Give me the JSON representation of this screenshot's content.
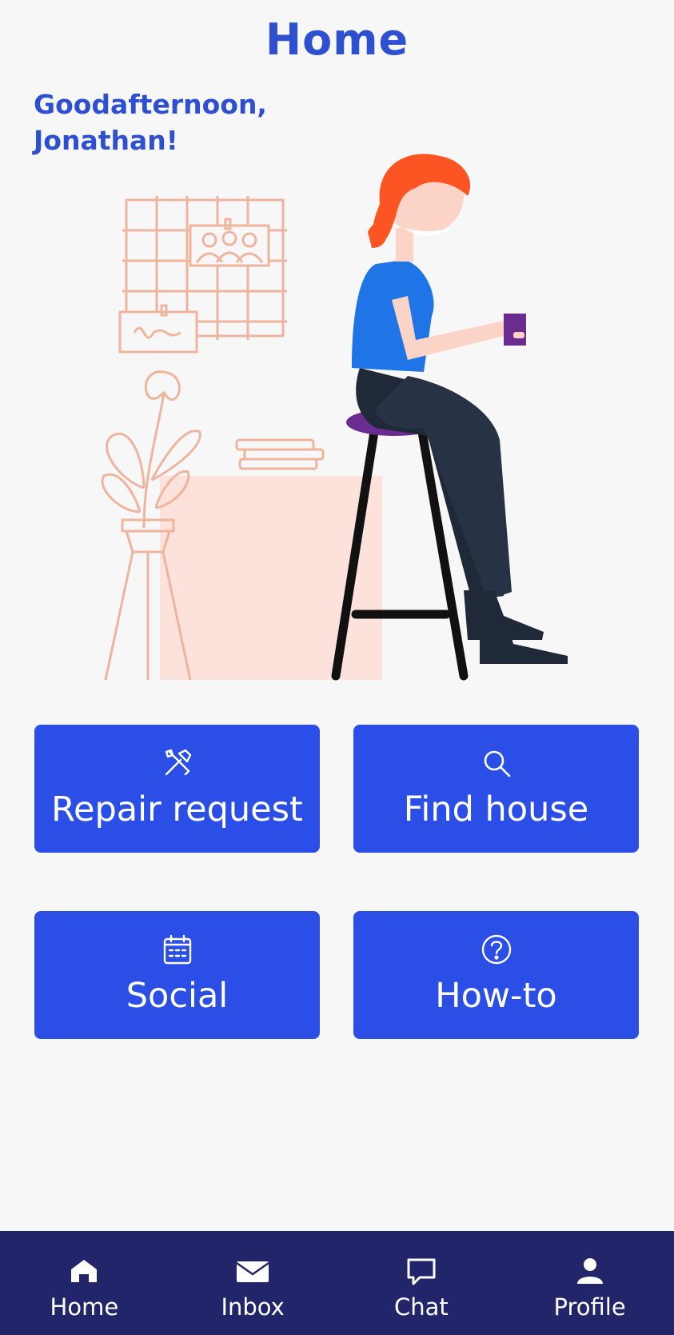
{
  "header": {
    "title": "Home"
  },
  "greeting": {
    "text": "Goodafternoon, Jonathan!"
  },
  "colors": {
    "accent": "#2f4fd1",
    "tile_bg": "#2a4ee6",
    "nav_bg": "#22256a",
    "background": "#f7f7f7"
  },
  "tiles": [
    {
      "label": "Repair request",
      "icon": "tools-icon"
    },
    {
      "label": "Find house",
      "icon": "search-icon"
    },
    {
      "label": "Social",
      "icon": "calendar-icon"
    },
    {
      "label": "How-to",
      "icon": "help-icon"
    }
  ],
  "bottom_nav": {
    "items": [
      {
        "label": "Home",
        "icon": "home-icon",
        "active": true
      },
      {
        "label": "Inbox",
        "icon": "mail-icon"
      },
      {
        "label": "Chat",
        "icon": "chat-icon"
      },
      {
        "label": "Profile",
        "icon": "user-icon"
      }
    ]
  }
}
